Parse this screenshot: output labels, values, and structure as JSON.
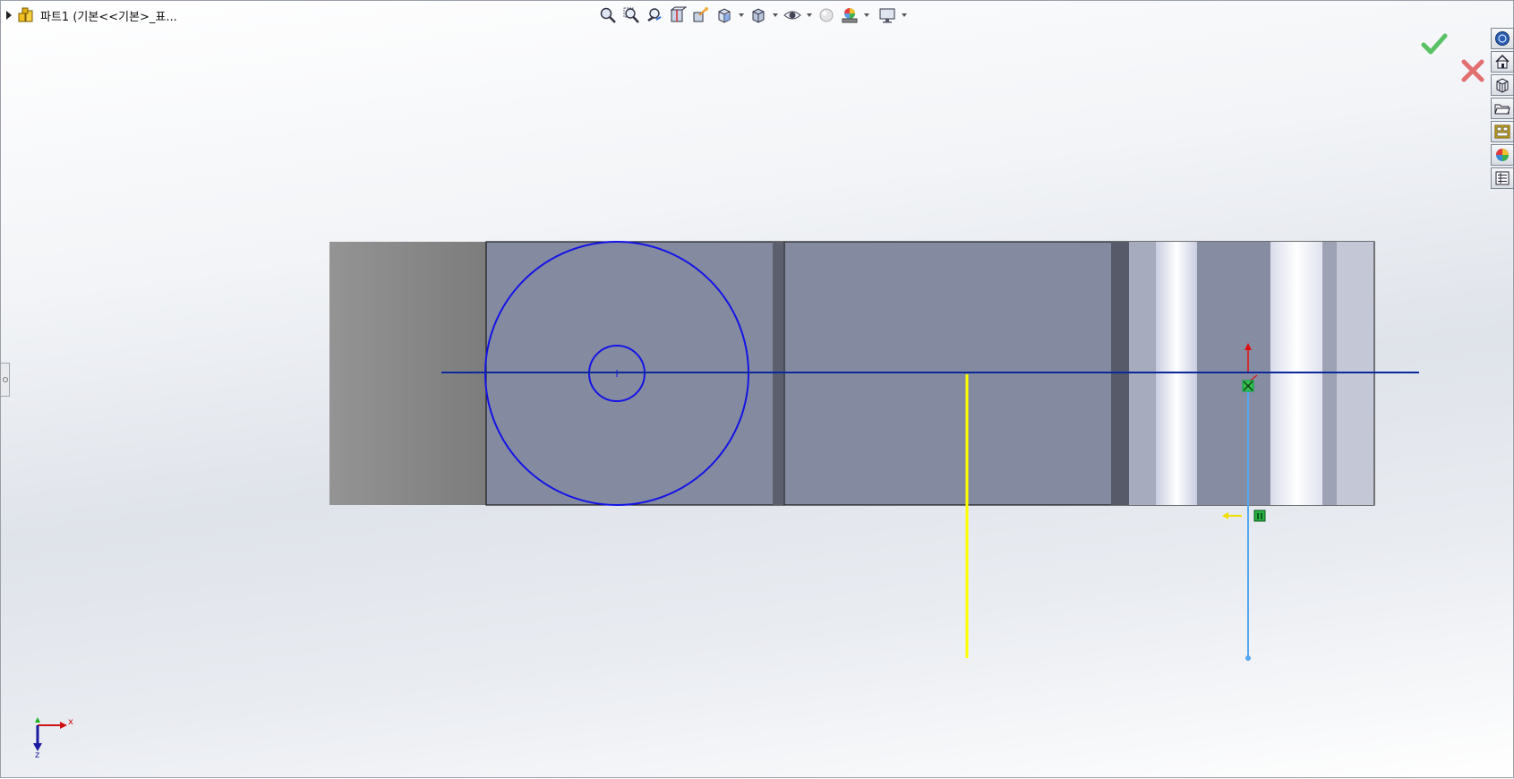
{
  "window": {
    "tree_label": "파트1  (기본<<기본>_표..."
  },
  "hud_toolbar": {
    "buttons": [
      {
        "name": "zoom-to-fit-icon"
      },
      {
        "name": "zoom-to-area-icon"
      },
      {
        "name": "previous-view-icon"
      },
      {
        "name": "section-view-icon"
      },
      {
        "name": "dynamic-annotation-view-icon"
      },
      {
        "name": "view-orientation-icon",
        "has_menu": true
      },
      {
        "name": "display-style-icon",
        "has_menu": true
      },
      {
        "name": "hide-show-items-icon",
        "has_menu": true
      },
      {
        "name": "edit-appearance-icon"
      },
      {
        "name": "apply-scene-icon",
        "has_menu": true
      },
      {
        "name": "view-settings-icon",
        "has_menu": true
      }
    ]
  },
  "taskpane": {
    "tabs": [
      {
        "name": "solidworks-resources-icon"
      },
      {
        "name": "home-icon"
      },
      {
        "name": "design-library-icon"
      },
      {
        "name": "file-explorer-icon"
      },
      {
        "name": "view-palette-icon"
      },
      {
        "name": "appearances-icon"
      },
      {
        "name": "custom-properties-icon"
      }
    ]
  },
  "triad": {
    "x_label": "x",
    "z_label": "z"
  },
  "colors": {
    "sketch_blue": "#1414e6",
    "centerline_blue": "#0a2a9a",
    "part_face": "#848aa0",
    "highlight_yellow": "#ffff00",
    "dimension_blue": "#55a8f0",
    "confirm_green": "#3cb84a",
    "cancel_red": "#e05050"
  }
}
